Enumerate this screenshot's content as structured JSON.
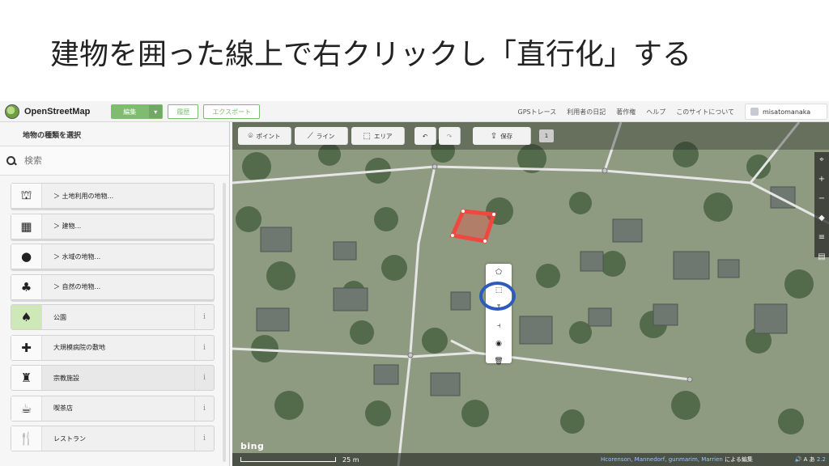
{
  "slide": {
    "title": "建物を囲った線上で右クリックし「直行化」する"
  },
  "osm": {
    "logo_text": "OpenStreetMap",
    "nav": {
      "edit_label": "編集",
      "dropdown_glyph": "▾",
      "history_label": "履歴",
      "export_label": "エクスポート"
    },
    "right_links": [
      "GPSトレース",
      "利用者の日記",
      "著作権",
      "ヘルプ",
      "このサイトについて"
    ],
    "user": "misatomanaka"
  },
  "sidebar": {
    "header": "地物の種類を選択",
    "search_placeholder": "検索",
    "presets": [
      {
        "label": "＞ 土地利用の地物...",
        "icon": "landuse-icon",
        "glyph": "⛫",
        "folder": true
      },
      {
        "label": "＞ 建物...",
        "icon": "building-icon",
        "glyph": "▦",
        "folder": true
      },
      {
        "label": "＞ 水域の地物...",
        "icon": "water-drop-icon",
        "glyph": "●",
        "folder": true
      },
      {
        "label": "＞ 自然の地物...",
        "icon": "nature-icon",
        "glyph": "♣",
        "folder": true
      },
      {
        "label": "公園",
        "icon": "park-tree-icon",
        "glyph": "♠",
        "folder": false,
        "info": "i"
      },
      {
        "label": "大規模病院の敷地",
        "icon": "hospital-cross-icon",
        "glyph": "✚",
        "folder": false,
        "info": "i"
      },
      {
        "label": "宗教施設",
        "icon": "place-of-worship-icon",
        "glyph": "♜",
        "folder": false,
        "info": "i"
      },
      {
        "label": "喫茶店",
        "icon": "cafe-cup-icon",
        "glyph": "☕",
        "folder": false,
        "info": "i"
      },
      {
        "label": "レストラン",
        "icon": "restaurant-icon",
        "glyph": "🍴",
        "folder": false,
        "info": "i"
      }
    ]
  },
  "map": {
    "toolbar": {
      "point_label": "ポイント",
      "line_label": "ライン",
      "area_label": "エリア",
      "undo_glyph": "↶",
      "redo_glyph": "↷",
      "save_label": "保存",
      "edit_count": "1"
    },
    "controls": [
      "⌖",
      "+",
      "−",
      "◆",
      "≡",
      "▤"
    ],
    "context_menu": [
      "⬠",
      "⬚",
      "↧",
      "⫞",
      "◉",
      "🗑"
    ],
    "bing_logo": "bing",
    "scale_label": "25 m",
    "attribution_names": "Hcorenson, Mannedorf, gunmarim, Marrien",
    "attribution_suffix": "による編集",
    "attribution_icons": "🔊 A あ",
    "version": "2.2"
  },
  "colors": {
    "osm_green": "#7ebc6f",
    "selection_red": "#f0473f",
    "highlight_blue": "#2d5bbd"
  }
}
